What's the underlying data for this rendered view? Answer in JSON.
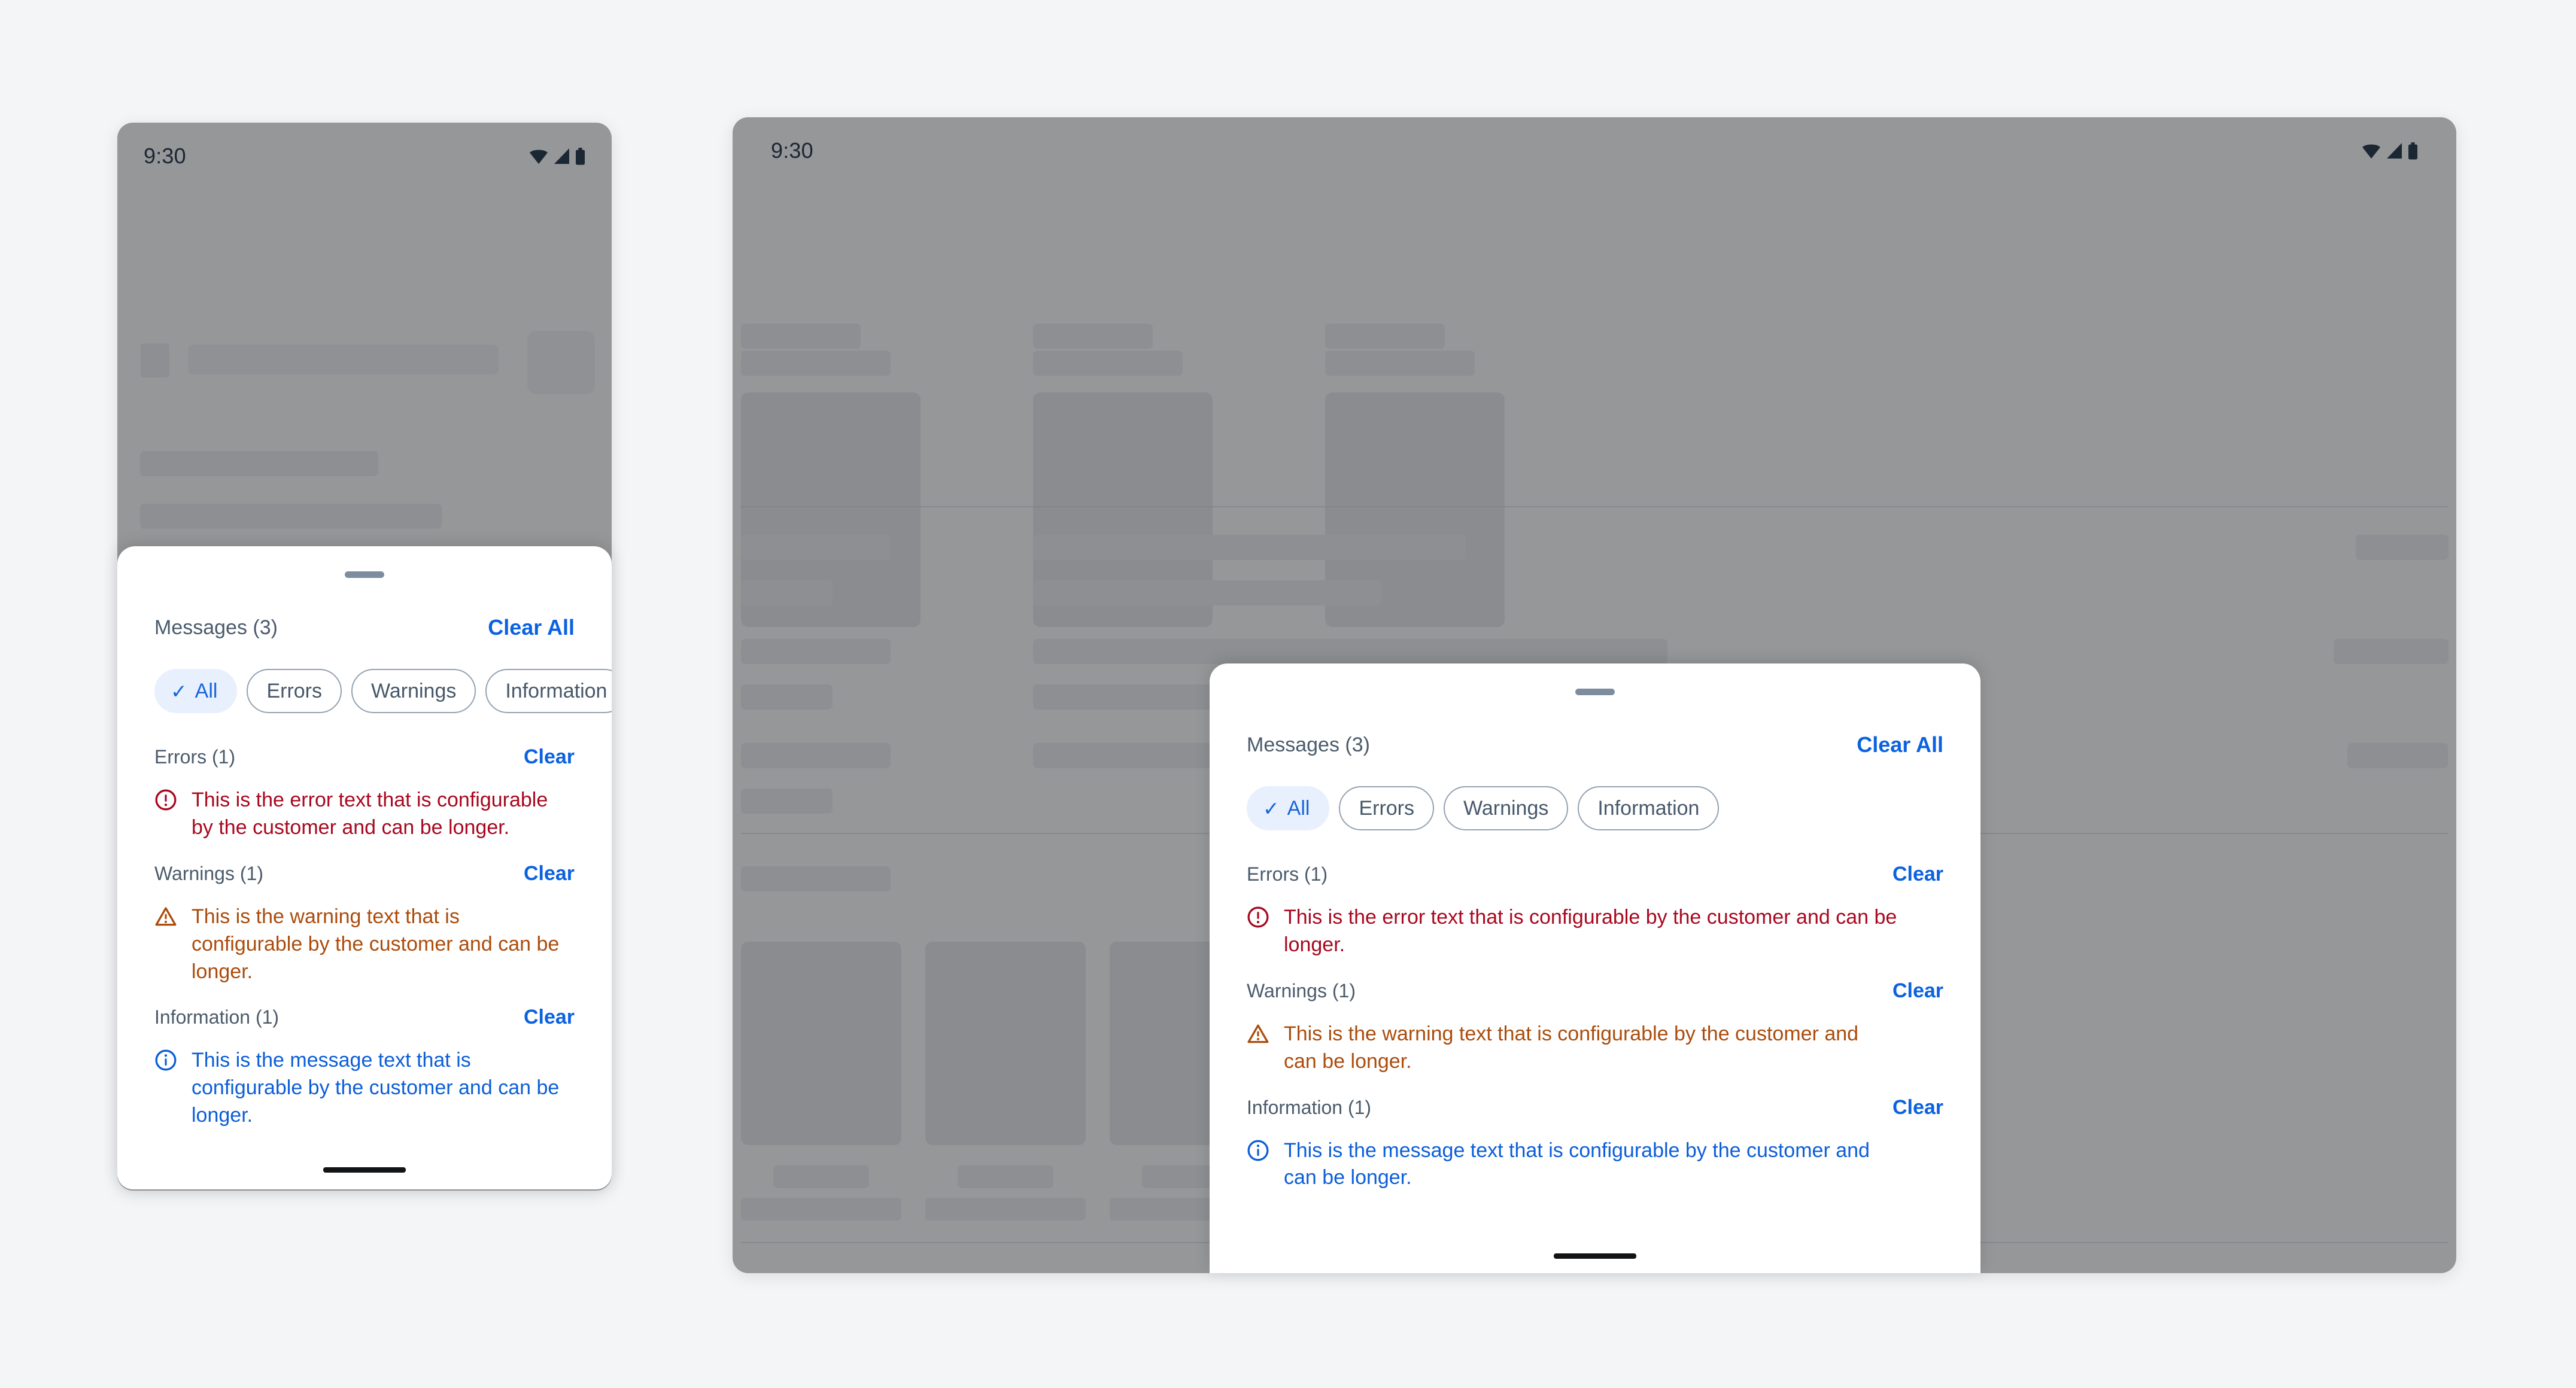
{
  "colors": {
    "page_background": "#f4f5f7",
    "device_background": "#969799",
    "skeleton": "#8d8f93",
    "sheet_background": "#ffffff",
    "accent_link": "#0b62e0",
    "chip_selected_background": "#e9f0fd",
    "chip_selected_text": "#1565d8",
    "chip_border": "#94a2b1",
    "chip_text": "#47586a",
    "error": "#a8081f",
    "warning": "#ab4c0c",
    "information": "#0b5ed8",
    "label_text": "#4b5b6b",
    "handle": "#7e8d9e",
    "home_indicator": "#111315"
  },
  "status_bar": {
    "time": "9:30",
    "icons": [
      "wifi-icon",
      "cellular-signal-icon",
      "battery-icon"
    ]
  },
  "sheet": {
    "drag_handle_name": "drag-handle",
    "title": "Messages (3)",
    "clear_all_label": "Clear All",
    "chips": [
      {
        "label": "All",
        "selected": true,
        "icon": "check-icon"
      },
      {
        "label": "Errors",
        "selected": false,
        "icon": null
      },
      {
        "label": "Warnings",
        "selected": false,
        "icon": null
      },
      {
        "label": "Information",
        "selected": false,
        "icon": null
      }
    ],
    "groups": [
      {
        "label": "Errors (1)",
        "clear_label": "Clear",
        "severity": "error",
        "icon": "error-circle-icon",
        "message": "This is the error text that is configurable by the customer and can be longer."
      },
      {
        "label": "Warnings (1)",
        "clear_label": "Clear",
        "severity": "warning",
        "icon": "warning-triangle-icon",
        "message": "This is the warning text that is configurable by the customer and can be longer."
      },
      {
        "label": "Information (1)",
        "clear_label": "Clear",
        "severity": "information",
        "icon": "info-circle-icon",
        "message": "This is the message text that is configurable by the customer and can be longer."
      }
    ]
  }
}
